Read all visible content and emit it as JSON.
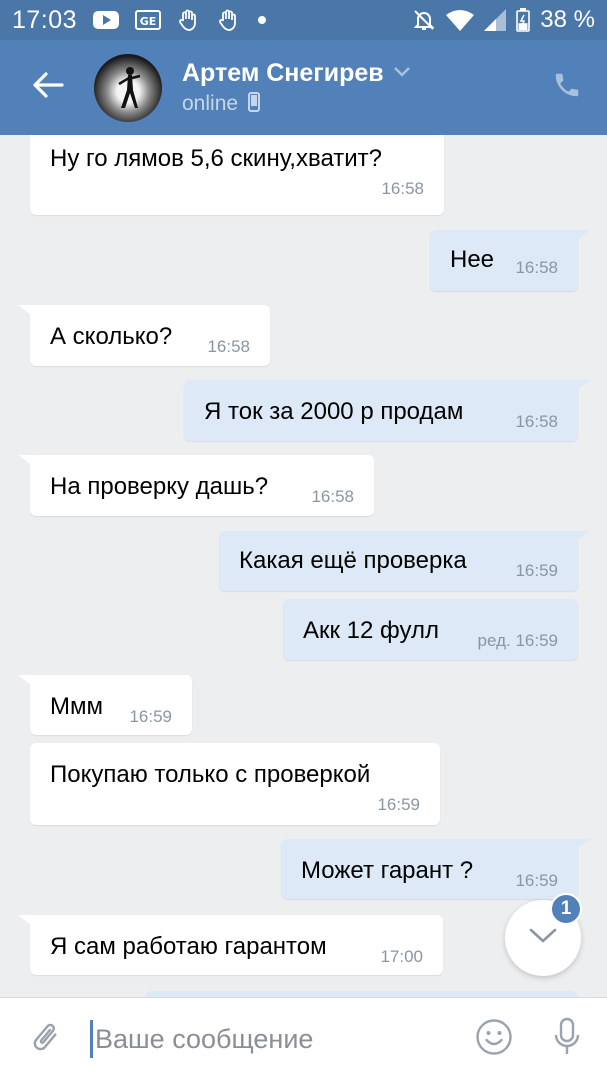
{
  "status_bar": {
    "time": "17:03",
    "battery_percent": "38 %",
    "battery_level": 0.38,
    "icons": [
      "youtube-icon",
      "ge-icon",
      "hand-icon",
      "hand-icon",
      "dot-icon",
      "mute-bell-icon",
      "wifi-icon",
      "signal-icon",
      "battery-icon"
    ]
  },
  "header": {
    "name": "Артем Снегирев",
    "status": "online",
    "icons": [
      "back-arrow-icon",
      "chevron-down-icon",
      "mobile-icon",
      "phone-icon"
    ]
  },
  "messages": [
    {
      "dir": "in",
      "text": "Ну го лямов 5,6 скину,хватит?",
      "time": "16:58"
    },
    {
      "dir": "out",
      "text": "Нее",
      "time": "16:58"
    },
    {
      "dir": "in",
      "text": "А сколько?",
      "time": "16:58"
    },
    {
      "dir": "out",
      "text": "Я ток за 2000 р продам",
      "time": "16:58"
    },
    {
      "dir": "in",
      "text": "На проверку дашь?",
      "time": "16:58"
    },
    {
      "dir": "out",
      "text": "Какая ещё проверка",
      "time": "16:59"
    },
    {
      "dir": "out",
      "text": "Акк 12 фулл",
      "time": "ред. 16:59"
    },
    {
      "dir": "in",
      "text": "Ммм",
      "time": "16:59"
    },
    {
      "dir": "in",
      "text": "Покупаю только с проверкой",
      "time": "16:59"
    },
    {
      "dir": "out",
      "text": "Может гарант ?",
      "time": "16:59"
    },
    {
      "dir": "in",
      "text": "Я сам работаю гарантом",
      "time": "17:00"
    }
  ],
  "scroll_button": {
    "badge": "1",
    "icon": "chevron-down-icon"
  },
  "composer": {
    "placeholder": "Ваше сообщение",
    "icons": [
      "paperclip-icon",
      "smile-icon",
      "microphone-icon"
    ]
  },
  "colors": {
    "header": "#5181b8",
    "status_bar": "#4a76a8",
    "incoming_bubble": "#ffffff",
    "outgoing_bubble": "#dde9f6",
    "background": "#edeef0"
  }
}
